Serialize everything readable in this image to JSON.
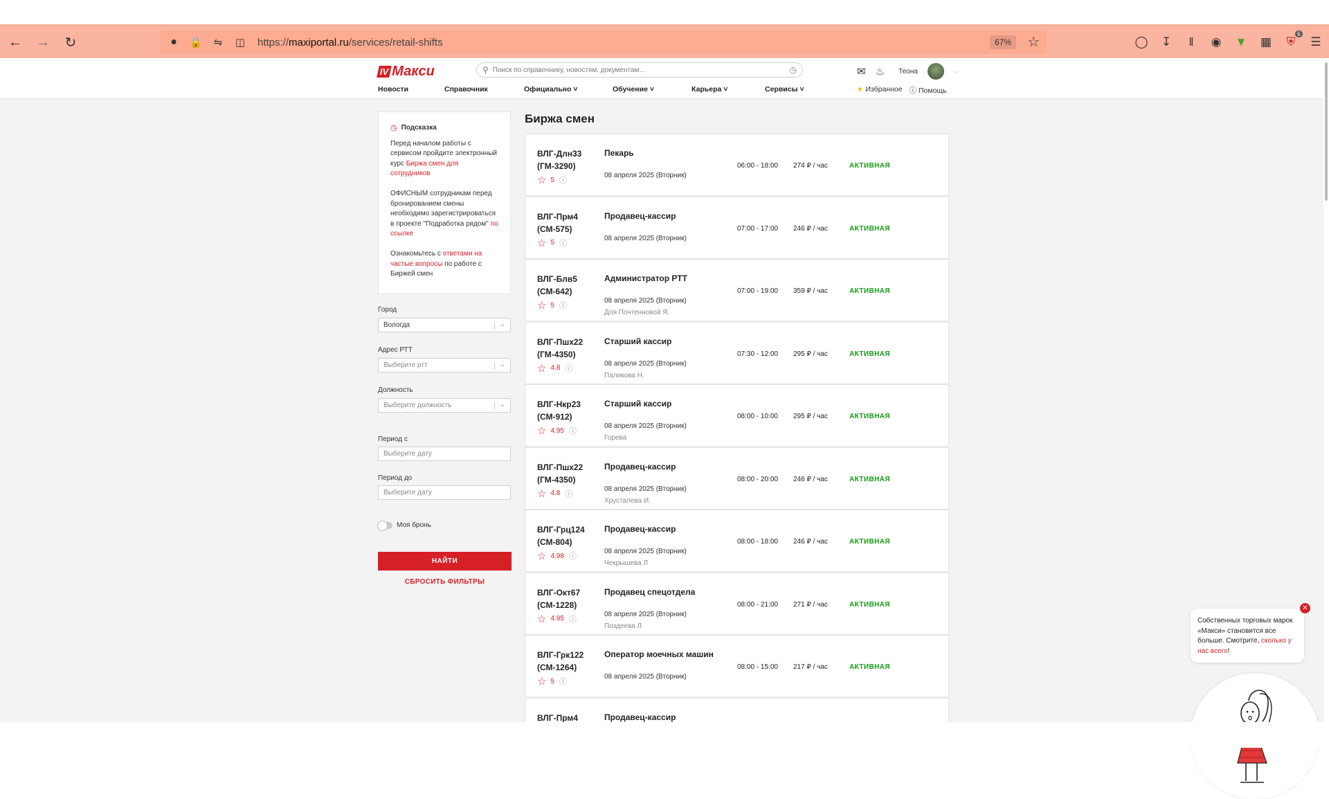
{
  "browser": {
    "url_prefix": "https://",
    "url_host": "maxiportal.ru",
    "url_path": "/services/retail-shifts",
    "zoom": "67%",
    "extension_badge": "6"
  },
  "header": {
    "logo_mark": "IV",
    "logo_text": "Макси",
    "search_placeholder": "Поиск по справочнику, новостям, документам...",
    "user_name": "Теона",
    "nav": [
      {
        "label": "Новости",
        "dropdown": false
      },
      {
        "label": "Справочник",
        "dropdown": false
      },
      {
        "label": "Официально",
        "dropdown": true
      },
      {
        "label": "Обучение",
        "dropdown": true
      },
      {
        "label": "Карьера",
        "dropdown": true
      },
      {
        "label": "Сервисы",
        "dropdown": true
      }
    ],
    "favorites": "Избранное",
    "help": "Помощь"
  },
  "hint": {
    "title": "Подсказка",
    "p1_text": "Перед началом работы с сервисом пройдите электронный курс ",
    "p1_link": "Биржа смен для сотрудников",
    "p2_text": "ОФИСНЫМ сотрудникам перед бронированием смены необходимо зарегистрироваться в проекте \"Подработка рядом\" ",
    "p2_link": "по ссылке",
    "p3_pre": "Ознакомьтесь с ",
    "p3_link": "ответами на частые вопросы",
    "p3_post": " по работе с Биржей смен"
  },
  "filters": {
    "city_label": "Город",
    "city_value": "Вологда",
    "address_label": "Адрес РТТ",
    "address_placeholder": "Выберите ртт",
    "position_label": "Должность",
    "position_placeholder": "Выберите должность",
    "from_label": "Период с",
    "from_placeholder": "Выберите дату",
    "to_label": "Период до",
    "to_placeholder": "Выберите дату",
    "my_booking_label": "Моя бронь",
    "find_button": "НАЙТИ",
    "reset_link": "СБРОСИТЬ ФИЛЬТРЫ"
  },
  "page_title": "Биржа смен",
  "shifts": [
    {
      "code1": "ВЛГ-Длн33",
      "code2": "(ГМ-3290)",
      "rating": "5",
      "position": "Пекарь",
      "date": "08 апреля 2025 (Вторник)",
      "employee": "",
      "time": "06:00 - 18:00",
      "rate": "274 ₽ / час",
      "status": "АКТИВНАЯ"
    },
    {
      "code1": "ВЛГ-Прм4",
      "code2": "(СМ-575)",
      "rating": "5",
      "position": "Продавец-кассир",
      "date": "08 апреля 2025 (Вторник)",
      "employee": "",
      "time": "07:00 - 17:00",
      "rate": "246 ₽ / час",
      "status": "АКТИВНАЯ"
    },
    {
      "code1": "ВЛГ-Блв5",
      "code2": "(СМ-642)",
      "rating": "5",
      "position": "Администратор РТТ",
      "date": "08 апреля 2025 (Вторник)",
      "employee": "Для Почтенновой Я.",
      "time": "07:00 - 19:00",
      "rate": "359 ₽ / час",
      "status": "АКТИВНАЯ"
    },
    {
      "code1": "ВЛГ-Пшх22",
      "code2": "(ГМ-4350)",
      "rating": "4.8",
      "position": "Старший кассир",
      "date": "08 апреля 2025 (Вторник)",
      "employee": "Паликова Н.",
      "time": "07:30 - 12:00",
      "rate": "295 ₽ / час",
      "status": "АКТИВНАЯ"
    },
    {
      "code1": "ВЛГ-Нкр23",
      "code2": "(СМ-912)",
      "rating": "4.95",
      "position": "Старший кассир",
      "date": "08 апреля 2025 (Вторник)",
      "employee": "Горева",
      "time": "08:00 - 10:00",
      "rate": "295 ₽ / час",
      "status": "АКТИВНАЯ"
    },
    {
      "code1": "ВЛГ-Пшх22",
      "code2": "(ГМ-4350)",
      "rating": "4.8",
      "position": "Продавец-кассир",
      "date": "08 апреля 2025 (Вторник)",
      "employee": "Хрусталева И.",
      "time": "08:00 - 20:00",
      "rate": "246 ₽ / час",
      "status": "АКТИВНАЯ"
    },
    {
      "code1": "ВЛГ-Грц124",
      "code2": "(СМ-804)",
      "rating": "4.98",
      "position": "Продавец-кассир",
      "date": "08 апреля 2025 (Вторник)",
      "employee": "Чекрышева Л",
      "time": "08:00 - 18:00",
      "rate": "246 ₽ / час",
      "status": "АКТИВНАЯ"
    },
    {
      "code1": "ВЛГ-Окт67",
      "code2": "(СМ-1228)",
      "rating": "4.95",
      "position": "Продавец спецотдела",
      "date": "08 апреля 2025 (Вторник)",
      "employee": "Поздеева Л",
      "time": "08:00 - 21:00",
      "rate": "271 ₽ / час",
      "status": "АКТИВНАЯ"
    },
    {
      "code1": "ВЛГ-Грк122",
      "code2": "(СМ-1264)",
      "rating": "5",
      "position": "Оператор моечных машин",
      "date": "08 апреля 2025 (Вторник)",
      "employee": "",
      "time": "08:00 - 15:00",
      "rate": "217 ₽ / час",
      "status": "АКТИВНАЯ"
    },
    {
      "code1": "ВЛГ-Прм4",
      "code2": "",
      "rating": "",
      "position": "Продавец-кассир",
      "date": "",
      "employee": "",
      "time": "",
      "rate": "",
      "status": ""
    }
  ],
  "bubble": {
    "text": "Собственных торговых марок «Макси» становится все больше. Смотрите, ",
    "link": "сколько у нас всего",
    "tail": "!"
  },
  "colors": {
    "brand": "#d71f26",
    "active_status": "#159a16",
    "browser_toolbar": "#fbb49f"
  }
}
